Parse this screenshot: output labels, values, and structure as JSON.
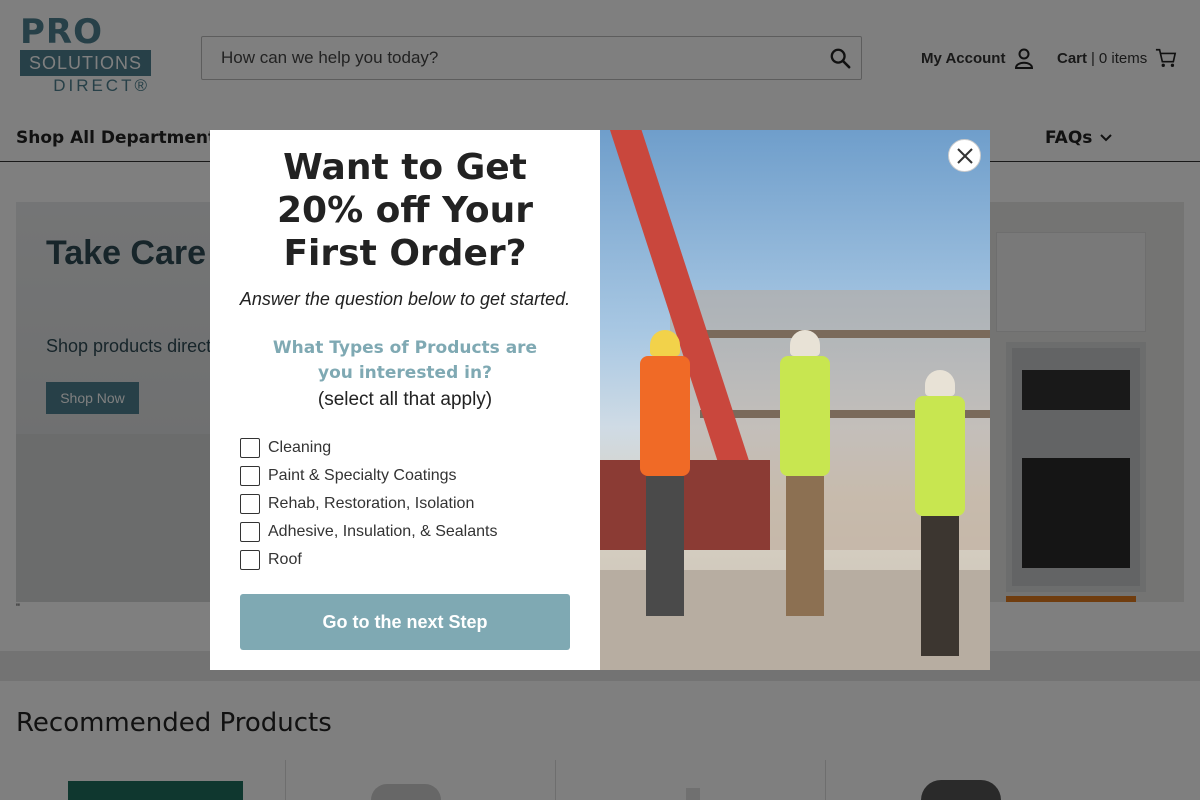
{
  "header": {
    "logo": {
      "line1": "PRO",
      "line2": "SOLUTIONS",
      "line3": "DIRECT®"
    },
    "search_placeholder": "How can we help you today?",
    "account_label": "My Account",
    "cart_label": "Cart",
    "cart_separator": "|",
    "cart_count": "0 items"
  },
  "nav": {
    "items": [
      {
        "label": "Shop All Departments"
      },
      {
        "label": "FAQs"
      }
    ]
  },
  "hero": {
    "title": "Take Care of What You Love with",
    "subtitle": "Shop products directly",
    "button_label": "Shop Now",
    "stray_mark": "\""
  },
  "recommended": {
    "title": "Recommended Products"
  },
  "modal": {
    "heading": "Want to Get 20% off Your First Order?",
    "subheading": "Answer the question below to get started.",
    "question": "What Types of Products are you interested in?",
    "note": "(select all that apply)",
    "options": [
      {
        "label": "Cleaning",
        "checked": false
      },
      {
        "label": "Paint & Specialty Coatings",
        "checked": false
      },
      {
        "label": "Rehab, Restoration, Isolation",
        "checked": false
      },
      {
        "label": "Adhesive, Insulation, & Sealants",
        "checked": false
      },
      {
        "label": "Roof",
        "checked": false
      }
    ],
    "button_label": "Go to the next Step",
    "image_icon": "construction-workers-photo"
  },
  "icons": {
    "search": "search-icon",
    "account": "user-icon",
    "cart": "cart-icon",
    "close": "close-icon",
    "chevron": "chevron-down-icon"
  },
  "colors": {
    "brand": "#4e8190",
    "accent_light": "#7fa9b3",
    "overlay": "rgba(0,0,0,0.5)"
  }
}
